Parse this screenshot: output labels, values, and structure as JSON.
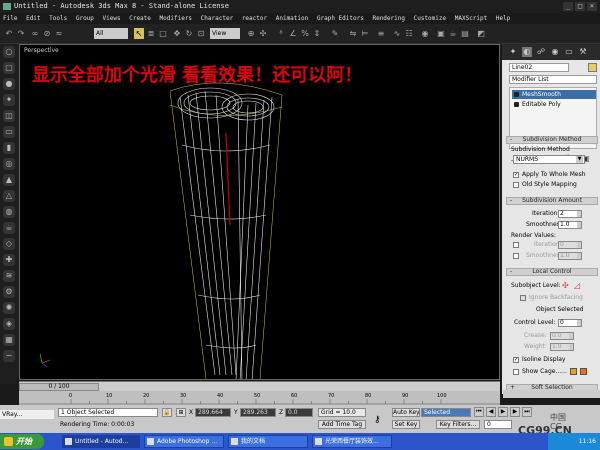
{
  "titlebar": {
    "title": "Untitled - Autodesk 3ds Max 8 - Stand-alone License",
    "min": "_",
    "max": "□",
    "close": "×"
  },
  "menu": [
    "File",
    "Edit",
    "Tools",
    "Group",
    "Views",
    "Create",
    "Modifiers",
    "Character",
    "reactor",
    "Animation",
    "Graph Editors",
    "Rendering",
    "Customize",
    "MAXScript",
    "Help"
  ],
  "toolbar": {
    "selection_filter": "All",
    "ref_coord": "View"
  },
  "viewport": {
    "label": "Perspective",
    "overlay_text": "显示全部加个光滑 看看效果！还可以阿！",
    "overlay_color": "#e00010"
  },
  "command_panel": {
    "object_name": "Line02",
    "object_color": "#e6cc66",
    "modifier_list": "Modifier List",
    "stack": [
      "MeshSmooth",
      "Editable Poly"
    ],
    "subdivision_method": {
      "header": "Subdivision Method",
      "label": "Subdivision Method",
      "value": "NURMS",
      "apply_whole_mesh": "Apply To Whole Mesh",
      "old_style_mapping": "Old Style Mapping"
    },
    "subdivision_amount": {
      "header": "Subdivision Amount",
      "iterations_label": "Iterations:",
      "iterations_value": "2",
      "smoothness_label": "Smoothness:",
      "smoothness_value": "1.0",
      "render_values": "Render Values:",
      "render_iterations_label": "Iterations:",
      "render_iterations_value": "0",
      "render_smoothness_label": "Smoothness:",
      "render_smoothness_value": "1.0"
    },
    "local_control": {
      "header": "Local Control",
      "subobject_label": "Subobject Level:",
      "ignore_backfacing": "Ignore Backfacing",
      "object_selected": "Object Selected",
      "control_level_label": "Control Level:",
      "control_level_value": "0",
      "crease_label": "Crease:",
      "crease_value": "0.0",
      "weight_label": "Weight:",
      "weight_value": "1.0",
      "isoline_display": "Isoline Display",
      "show_cage": "Show Cage......",
      "cage_color_1": "#e8a020",
      "cage_color_2": "#f07010"
    },
    "soft_selection_header": "Soft Selection"
  },
  "timeline": {
    "slider_label": "0 / 100",
    "ticks": [
      "0",
      "10",
      "20",
      "30",
      "40",
      "50",
      "60",
      "70",
      "80",
      "90",
      "100"
    ]
  },
  "status": {
    "vray_label": "VRay...",
    "selection_info": "1 Object Selected",
    "render_time": "Rendering Time: 0:00:03",
    "x_label": "X",
    "x_value": "289.664",
    "y_label": "Y",
    "y_value": "289.263",
    "z_label": "Z",
    "z_value": "0.0",
    "grid": "Grid = 10.0",
    "add_time_tag": "Add Time Tag",
    "auto_key": "Auto Key",
    "selected": "Selected",
    "set_key": "Set Key",
    "key_filters": "Key Filters...",
    "frame": "0"
  },
  "taskbar": {
    "start": "开始",
    "tasks": [
      "Untitled - Autod...",
      "Adobe Photoshop ...",
      "我的文档",
      "光荣西餐厅装饰效..."
    ],
    "clock": "11:16"
  },
  "watermark": {
    "logo": "CG99.CN",
    "cn_top": "中国",
    "cn_bottom": "CG"
  }
}
